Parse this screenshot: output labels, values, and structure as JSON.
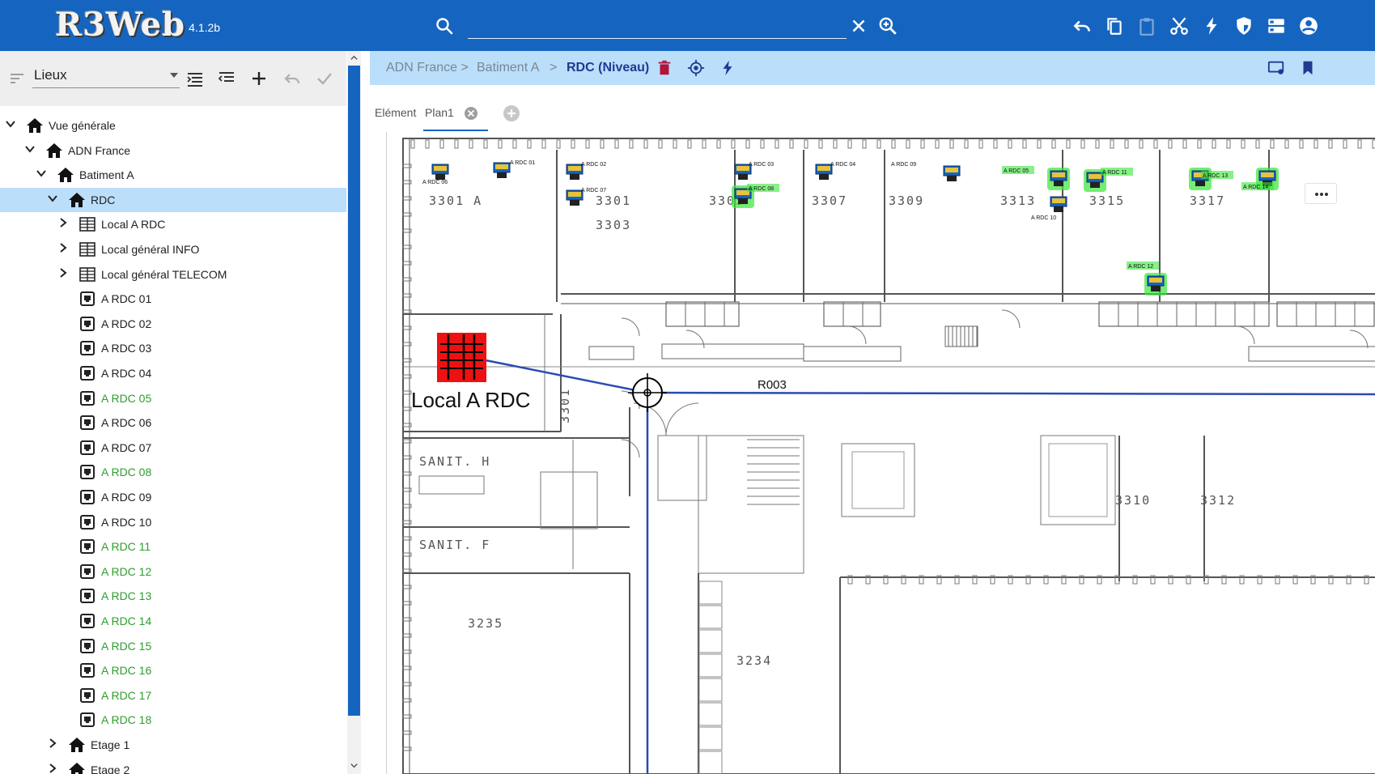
{
  "app": {
    "logo_text": "R3Web",
    "version": "4.1.2b"
  },
  "topbar": {
    "search_value": "",
    "icons": [
      "search-icon",
      "clear-icon",
      "zoom-in-icon",
      "undo-icon",
      "copy-icon",
      "paste-icon",
      "cut-icon",
      "flash-icon",
      "shield-icon",
      "list-icon",
      "account-icon"
    ]
  },
  "left": {
    "select_value": "Lieux",
    "toolbar_icons": [
      "sort-icon",
      "expand-all-icon",
      "collapse-all-icon",
      "add-icon",
      "undo-icon",
      "check-icon"
    ],
    "tree": [
      {
        "label": "Vue générale",
        "icon": "home",
        "depth": 0,
        "expanded": true,
        "chevron": true
      },
      {
        "label": "ADN France",
        "icon": "home",
        "depth": 1,
        "expanded": true,
        "chevron": true
      },
      {
        "label": "Batiment A",
        "icon": "home",
        "depth": 2,
        "expanded": true,
        "chevron": true
      },
      {
        "label": "RDC",
        "icon": "home",
        "depth": 3,
        "expanded": true,
        "chevron": true,
        "selected": true
      },
      {
        "label": "Local A RDC",
        "icon": "rack",
        "depth": 4,
        "chevron": true
      },
      {
        "label": "Local général INFO",
        "icon": "rack",
        "depth": 4,
        "chevron": true
      },
      {
        "label": "Local général TELECOM",
        "icon": "rack",
        "depth": 4,
        "chevron": true
      },
      {
        "label": "A RDC 01",
        "icon": "outlet",
        "depth": 4
      },
      {
        "label": "A RDC 02",
        "icon": "outlet",
        "depth": 4
      },
      {
        "label": "A RDC 03",
        "icon": "outlet",
        "depth": 4
      },
      {
        "label": "A RDC 04",
        "icon": "outlet",
        "depth": 4
      },
      {
        "label": "A RDC 05",
        "icon": "outlet",
        "depth": 4,
        "green": true
      },
      {
        "label": "A RDC 06",
        "icon": "outlet",
        "depth": 4
      },
      {
        "label": "A RDC 07",
        "icon": "outlet",
        "depth": 4
      },
      {
        "label": "A RDC 08",
        "icon": "outlet",
        "depth": 4,
        "green": true
      },
      {
        "label": "A RDC 09",
        "icon": "outlet",
        "depth": 4
      },
      {
        "label": "A RDC 10",
        "icon": "outlet",
        "depth": 4
      },
      {
        "label": "A RDC 11",
        "icon": "outlet",
        "depth": 4,
        "green": true
      },
      {
        "label": "A RDC 12",
        "icon": "outlet",
        "depth": 4,
        "green": true
      },
      {
        "label": "A RDC 13",
        "icon": "outlet",
        "depth": 4,
        "green": true
      },
      {
        "label": "A RDC 14",
        "icon": "outlet",
        "depth": 4,
        "green": true
      },
      {
        "label": "A RDC 15",
        "icon": "outlet",
        "depth": 4,
        "green": true
      },
      {
        "label": "A RDC 16",
        "icon": "outlet",
        "depth": 4,
        "green": true
      },
      {
        "label": "A RDC 17",
        "icon": "outlet",
        "depth": 4,
        "green": true
      },
      {
        "label": "A RDC 18",
        "icon": "outlet",
        "depth": 4,
        "green": true
      },
      {
        "label": "Etage 1",
        "icon": "home",
        "depth": 3,
        "chevron": true
      },
      {
        "label": "Etage 2",
        "icon": "home",
        "depth": 3,
        "chevron": true
      }
    ]
  },
  "breadcrumb": {
    "items": [
      "ADN France >",
      "Batiment A",
      ">"
    ],
    "current": "RDC (Niveau)"
  },
  "tabs": {
    "element_label": "Elément",
    "plan_label": "Plan1"
  },
  "plan": {
    "rooms": [
      "3301 A",
      "3301",
      "3303",
      "3305",
      "3307",
      "3309",
      "3313",
      "3315",
      "3317",
      "3301",
      "SANIT. H",
      "SANIT. F",
      "3310",
      "3312",
      "3235",
      "3234"
    ],
    "local_label": "Local A RDC",
    "route_label": "R003",
    "outlets": [
      {
        "label": "A RDC 01",
        "active": false
      },
      {
        "label": "A RDC 02",
        "active": false
      },
      {
        "label": "A RDC 03",
        "active": false
      },
      {
        "label": "A RDC 04",
        "active": false
      },
      {
        "label": "A RDC 05",
        "active": true
      },
      {
        "label": "A RDC 06",
        "active": false
      },
      {
        "label": "A RDC 07",
        "active": false
      },
      {
        "label": "A RDC 08",
        "active": true
      },
      {
        "label": "A RDC 09",
        "active": false
      },
      {
        "label": "A RDC 10",
        "active": false
      },
      {
        "label": "A RDC 11",
        "active": true
      },
      {
        "label": "A RDC 12",
        "active": true
      },
      {
        "label": "A RDC 13",
        "active": true
      },
      {
        "label": "A RDC 14",
        "active": true
      }
    ]
  },
  "colors": {
    "primary": "#1565c0",
    "selected_row": "#bbdefb",
    "green": "#2e9e2e",
    "outlet_glow": "#39e639",
    "local_red": "#ee1111"
  }
}
